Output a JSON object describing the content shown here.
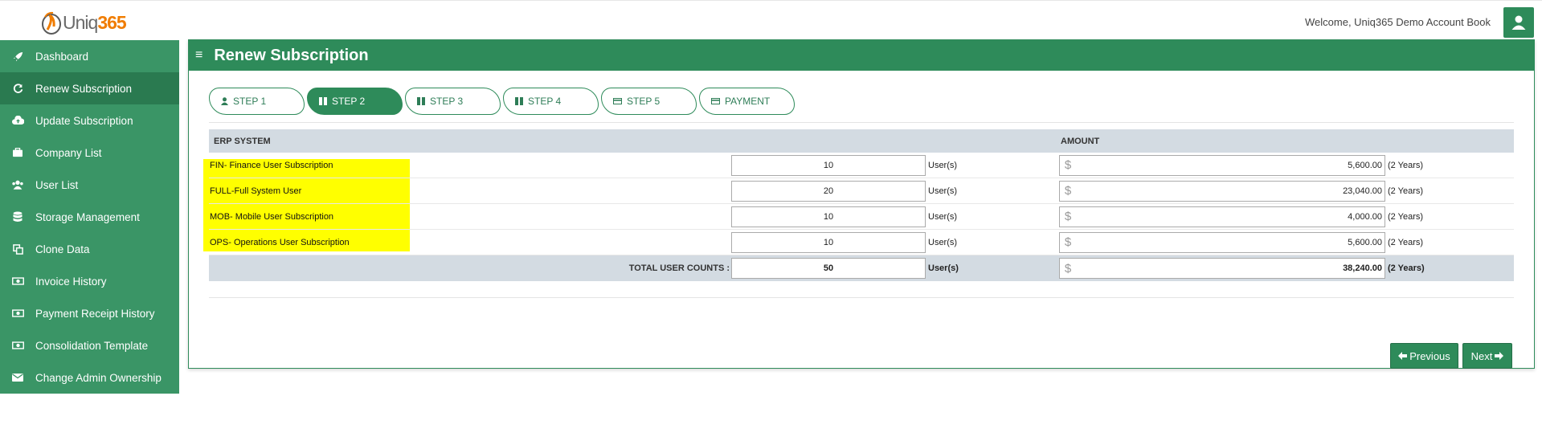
{
  "header": {
    "logo_text_a": "Uniq",
    "logo_text_b": "365",
    "welcome": "Welcome, Uniq365 Demo Account Book"
  },
  "sidebar": {
    "items": [
      {
        "label": "Dashboard",
        "icon": "rocket-icon",
        "active": false
      },
      {
        "label": "Renew Subscription",
        "icon": "refresh-icon",
        "active": true
      },
      {
        "label": "Update Subscription",
        "icon": "cloud-upload-icon",
        "active": false
      },
      {
        "label": "Company List",
        "icon": "briefcase-icon",
        "active": false
      },
      {
        "label": "User List",
        "icon": "users-icon",
        "active": false
      },
      {
        "label": "Storage Management",
        "icon": "database-icon",
        "active": false
      },
      {
        "label": "Clone Data",
        "icon": "copy-icon",
        "active": false
      },
      {
        "label": "Invoice History",
        "icon": "money-icon",
        "active": false
      },
      {
        "label": "Payment Receipt History",
        "icon": "money-icon",
        "active": false
      },
      {
        "label": "Consolidation Template",
        "icon": "money-icon",
        "active": false
      },
      {
        "label": "Change Admin Ownership",
        "icon": "envelope-icon",
        "active": false
      }
    ]
  },
  "main": {
    "title": "Renew Subscription",
    "steps": [
      {
        "label": "STEP 1",
        "active": false
      },
      {
        "label": "STEP 2",
        "active": true
      },
      {
        "label": "STEP 3",
        "active": false
      },
      {
        "label": "STEP 4",
        "active": false
      },
      {
        "label": "STEP 5",
        "active": false
      },
      {
        "label": "PAYMENT",
        "active": false
      }
    ],
    "table": {
      "col_erp": "ERP SYSTEM",
      "col_amount": "AMOUNT",
      "rows": [
        {
          "name": "FIN- Finance User Subscription",
          "qty": "10",
          "unit": "User(s)",
          "currency": "$",
          "amount": "5,600.00",
          "period": "(2 Years)"
        },
        {
          "name": "FULL-Full System User",
          "qty": "20",
          "unit": "User(s)",
          "currency": "$",
          "amount": "23,040.00",
          "period": "(2 Years)"
        },
        {
          "name": "MOB- Mobile User Subscription",
          "qty": "10",
          "unit": "User(s)",
          "currency": "$",
          "amount": "4,000.00",
          "period": "(2 Years)"
        },
        {
          "name": "OPS- Operations User Subscription",
          "qty": "10",
          "unit": "User(s)",
          "currency": "$",
          "amount": "5,600.00",
          "period": "(2 Years)"
        }
      ],
      "total": {
        "label": "TOTAL USER COUNTS :",
        "qty": "50",
        "unit": "User(s)",
        "currency": "$",
        "amount": "38,240.00",
        "period": "(2 Years)"
      }
    },
    "buttons": {
      "previous": "Previous",
      "next": "Next"
    }
  },
  "colors": {
    "primary": "#2e8b5a",
    "sidebar": "#3a9566",
    "highlight": "#ffff00",
    "accent": "#f07c00"
  }
}
